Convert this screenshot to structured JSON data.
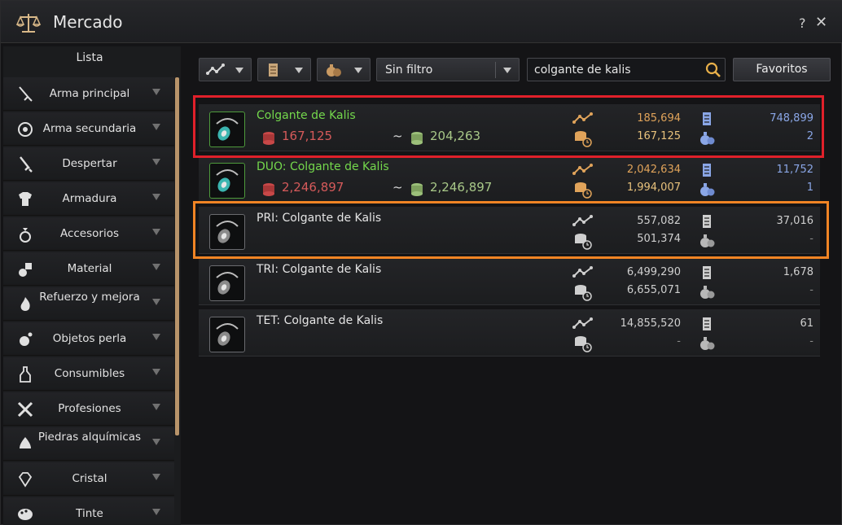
{
  "window": {
    "title": "Mercado",
    "help": "?",
    "close": "✕"
  },
  "sidebar": {
    "header": "Lista",
    "items": [
      {
        "label": "Arma principal",
        "icon": "sword-icon"
      },
      {
        "label": "Arma secundaria",
        "icon": "shield-icon"
      },
      {
        "label": "Despertar",
        "icon": "awakening-sword-icon"
      },
      {
        "label": "Armadura",
        "icon": "armor-icon"
      },
      {
        "label": "Accesorios",
        "icon": "ring-icon"
      },
      {
        "label": "Material",
        "icon": "material-icon"
      },
      {
        "label": "Refuerzo y mejora",
        "icon": "flame-icon"
      },
      {
        "label": "Objetos perla",
        "icon": "pearl-icon"
      },
      {
        "label": "Consumibles",
        "icon": "potion-icon"
      },
      {
        "label": "Profesiones",
        "icon": "tools-icon"
      },
      {
        "label": "Piedras alquímicas",
        "icon": "alchemy-stone-icon"
      },
      {
        "label": "Cristal",
        "icon": "crystal-icon"
      },
      {
        "label": "Tinte",
        "icon": "palette-icon"
      }
    ]
  },
  "filters": {
    "filter_select": "Sin filtro",
    "search_value": "colgante de kalis",
    "favorites_label": "Favoritos"
  },
  "results": [
    {
      "name": "Colgante de Kalis",
      "name_color": "green",
      "min_price": "167,125",
      "tilde": "~",
      "max_price": "204,263",
      "v1": "185,694",
      "v2": "167,125",
      "v3": "748,899",
      "v4": "2",
      "style": "enhanced"
    },
    {
      "name": "DUO: Colgante de Kalis",
      "name_color": "green",
      "min_price": "2,246,897",
      "tilde": "~",
      "max_price": "2,246,897",
      "v1": "2,042,634",
      "v2": "1,994,007",
      "v3": "11,752",
      "v4": "1",
      "style": "enhanced"
    },
    {
      "name": "PRI: Colgante de Kalis",
      "name_color": "white",
      "min_price": "",
      "tilde": "",
      "max_price": "",
      "v1": "557,082",
      "v2": "501,374",
      "v3": "37,016",
      "v4": "-",
      "style": "plain"
    },
    {
      "name": "TRI: Colgante de Kalis",
      "name_color": "white",
      "min_price": "",
      "tilde": "",
      "max_price": "",
      "v1": "6,499,290",
      "v2": "6,655,071",
      "v3": "1,678",
      "v4": "-",
      "style": "plain"
    },
    {
      "name": "TET: Colgante de Kalis",
      "name_color": "white",
      "min_price": "",
      "tilde": "",
      "max_price": "",
      "v1": "14,855,520",
      "v2": "-",
      "v3": "61",
      "v4": "-",
      "style": "plain"
    }
  ],
  "colors": {
    "highlight_red": "#e0202a",
    "highlight_orange": "#f08424",
    "item_name_green": "#74d84c",
    "price_min": "#d55a5a",
    "price_max": "#a8c888"
  }
}
